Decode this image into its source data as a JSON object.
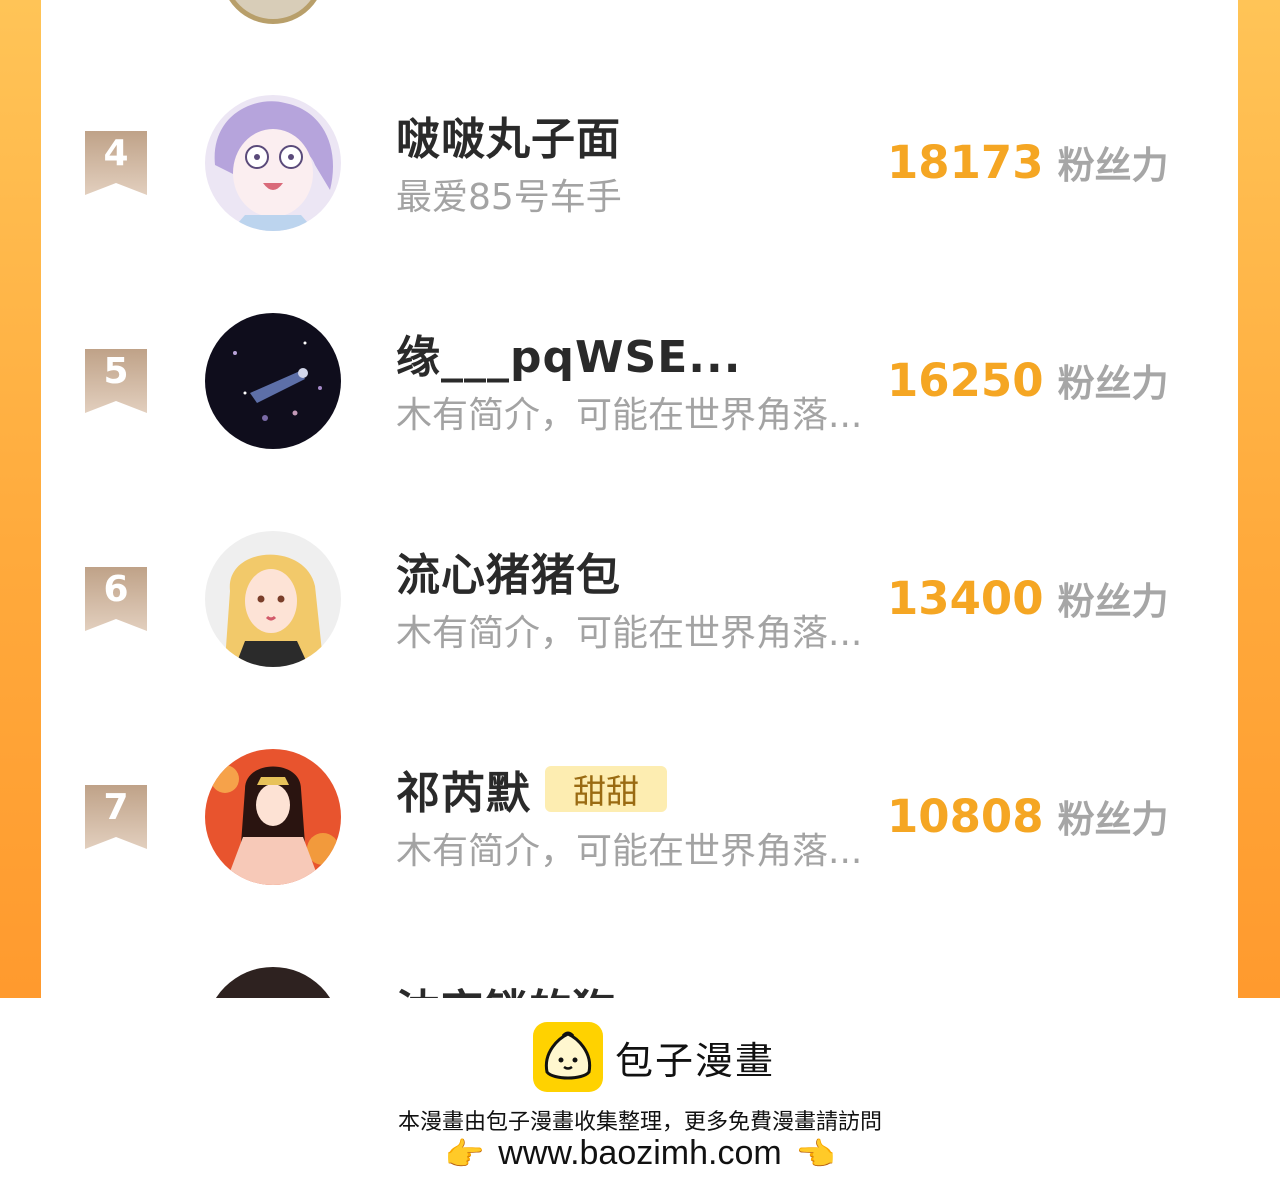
{
  "leaderboard": {
    "entries": [
      {
        "rank": "4",
        "name": "啵啵丸子面",
        "tag": "",
        "bio": "最爱85号车手",
        "score": "18173",
        "unit": "粉丝力",
        "avatar": "anime-girl-purple-avatar"
      },
      {
        "rank": "5",
        "name": "缘___pqWSE...",
        "tag": "",
        "bio": "木有简介，可能在世界角落...",
        "score": "16250",
        "unit": "粉丝力",
        "avatar": "night-sky-avatar"
      },
      {
        "rank": "6",
        "name": "流心猪猪包",
        "tag": "",
        "bio": "木有简介，可能在世界角落...",
        "score": "13400",
        "unit": "粉丝力",
        "avatar": "blonde-girl-avatar"
      },
      {
        "rank": "7",
        "name": "祁芮默",
        "tag": "甜甜",
        "bio": "木有简介，可能在世界角落...",
        "score": "10808",
        "unit": "粉丝力",
        "avatar": "red-dress-girl-avatar"
      }
    ],
    "partial_next_name": "沈宫锁的狗"
  },
  "footer": {
    "brand": "包子漫畫",
    "notice": "本漫畫由包子漫畫收集整理，更多免費漫畫請訪問",
    "url": "www.baozimh.com",
    "hand_left": "👉",
    "hand_right": "👈"
  },
  "colors": {
    "score": "#f5a623",
    "frame": "#ffaa3c",
    "badge": "#c8ab92",
    "tag_bg": "#fdedb1"
  }
}
